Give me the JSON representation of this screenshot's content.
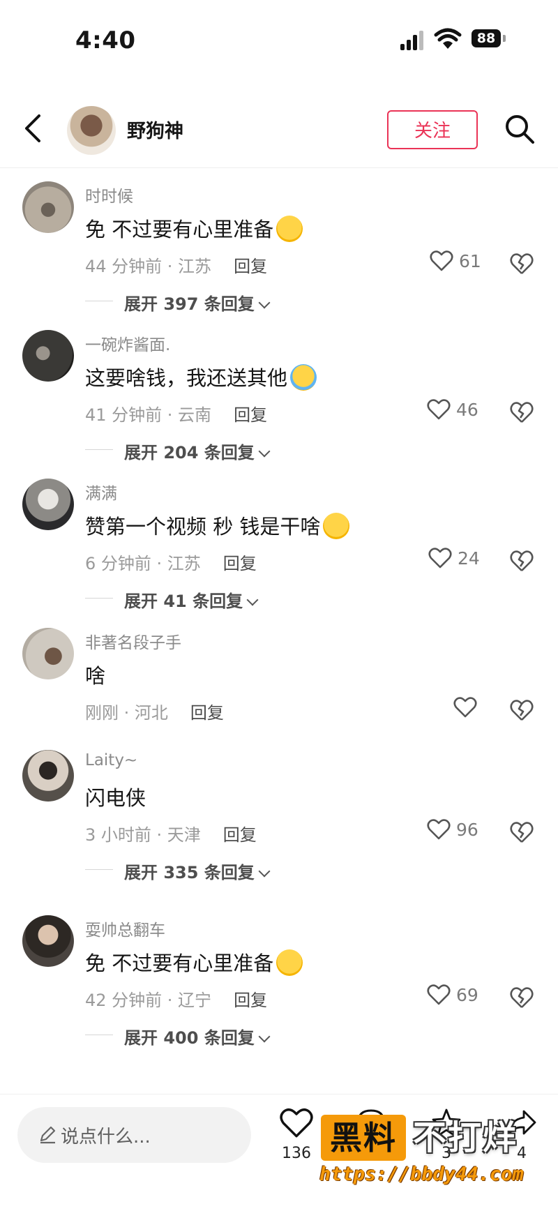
{
  "status_bar": {
    "time": "4:40",
    "battery": "88"
  },
  "header": {
    "username": "野狗神",
    "follow_label": "关注"
  },
  "comments": [
    {
      "user": "时时候",
      "text": "免 不过要有心里准备",
      "emoji": "yum-face",
      "time_loc": "44 分钟前 · 江苏",
      "reply": "回复",
      "likes": "61",
      "expand": "展开 397 条回复"
    },
    {
      "user": "一碗炸酱面.",
      "text": "这要啥钱，我还送其他",
      "emoji": "laughing-crying-face",
      "time_loc": "41 分钟前 · 云南",
      "reply": "回复",
      "likes": "46",
      "expand": "展开 204 条回复"
    },
    {
      "user": "满满",
      "text": "赞第一个视频 秒  钱是干啥",
      "emoji": "thinking-face",
      "time_loc": "6 分钟前 · 江苏",
      "reply": "回复",
      "likes": "24",
      "expand": "展开 41 条回复"
    },
    {
      "user": "非著名段子手",
      "text": "啥",
      "emoji": "",
      "time_loc": "刚刚 · 河北",
      "reply": "回复",
      "likes": "",
      "expand": ""
    },
    {
      "user": "Laity~",
      "text": "闪电侠",
      "emoji": "",
      "time_loc": "3 小时前 · 天津",
      "reply": "回复",
      "likes": "96",
      "expand": "展开 335 条回复"
    },
    {
      "user": "耍帅总翻车",
      "text": "免 不过要有心里准备",
      "emoji": "yum-face",
      "time_loc": "42 分钟前 · 辽宁",
      "reply": "回复",
      "likes": "69",
      "expand": "展开 400 条回复"
    }
  ],
  "bottom_bar": {
    "input_placeholder": "说点什么...",
    "like_count": "136",
    "favorite_count": "3",
    "share_count": "4"
  },
  "watermark": {
    "brand": "黑料",
    "tagline": "不打烊",
    "url": "https://bbdy44.com"
  },
  "colors": {
    "accent": "#ea3356",
    "watermark_orange": "#f59a0a"
  }
}
